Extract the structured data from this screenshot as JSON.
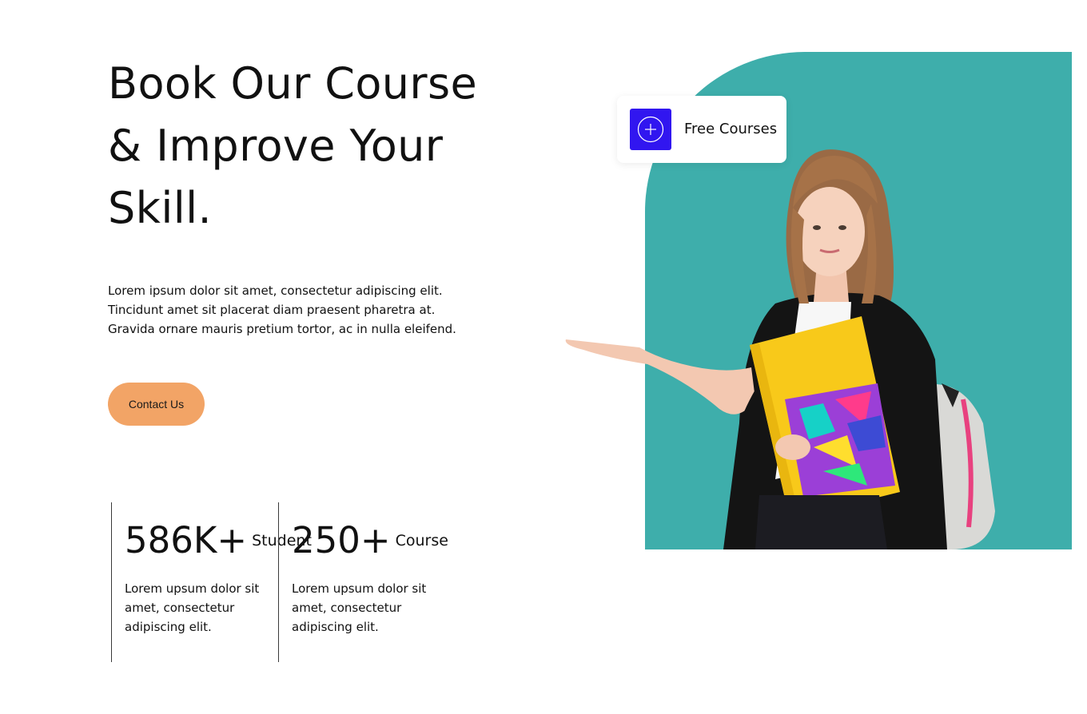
{
  "hero": {
    "title_lines": [
      "Book Our Course",
      "& Improve Your",
      "Skill."
    ],
    "description_lines": [
      "Lorem ipsum dolor sit amet, consectetur adipiscing elit.",
      "Tincidunt amet sit placerat diam praesent pharetra at.",
      "Gravida ornare mauris pretium tortor, ac in nulla eleifend."
    ],
    "contact_button_label": "Contact Us"
  },
  "stats": [
    {
      "value": "586K+",
      "label": "Student",
      "description_lines": [
        "Lorem upsum dolor sit",
        "amet, consectetur",
        "adipiscing elit."
      ]
    },
    {
      "value": "250+",
      "label": "Course",
      "description_lines": [
        "Lorem upsum dolor sit",
        "amet, consectetur",
        "adipiscing elit."
      ]
    }
  ],
  "course_card": {
    "label": "Free Courses",
    "icon": "plus-circle-icon"
  },
  "colors": {
    "accent_teal": "#3eaeab",
    "button_orange": "#f2a466",
    "badge_blue": "#3116f0",
    "text": "#111111"
  }
}
